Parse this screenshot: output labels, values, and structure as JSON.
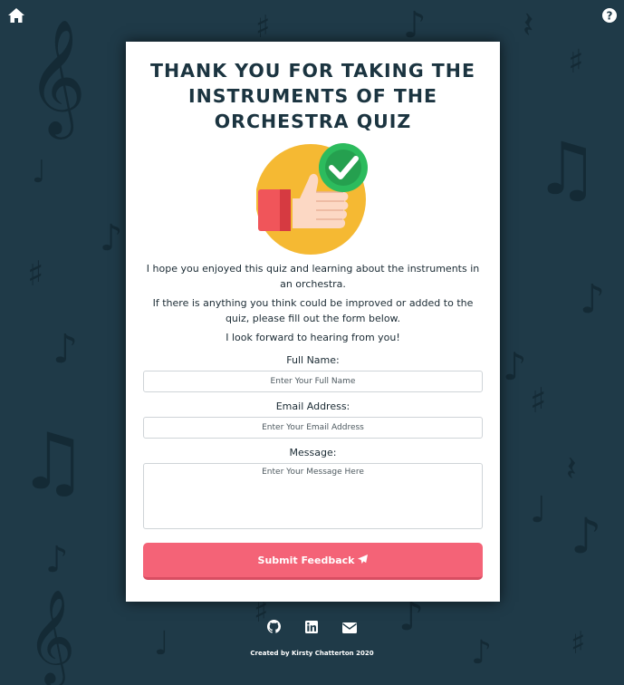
{
  "nav": {
    "home_icon": "home-icon",
    "help_icon": "help-icon"
  },
  "card": {
    "title": "THANK YOU FOR TAKING THE INSTRUMENTS OF THE ORCHESTRA QUIZ",
    "image_icon": "thumbs-up-check-icon",
    "message_1": "I hope you enjoyed this quiz and learning about the instruments in an orchestra.",
    "message_2": "If there is anything you think could be improved or added to the quiz, please fill out the form below.",
    "message_3": "I look forward to hearing from you!"
  },
  "form": {
    "name_label": "Full Name:",
    "name_placeholder": "Enter Your Full Name",
    "email_label": "Email Address:",
    "email_placeholder": "Enter Your Email Address",
    "message_label": "Message:",
    "message_placeholder": "Enter Your Message Here",
    "submit_label": "Submit Feedback"
  },
  "footer": {
    "icons": [
      "github-icon",
      "linkedin-icon",
      "envelope-icon"
    ],
    "credit": "Created by Kirsty Chatterton 2020"
  },
  "colors": {
    "background": "#1f3a48",
    "accent": "#f46377"
  }
}
